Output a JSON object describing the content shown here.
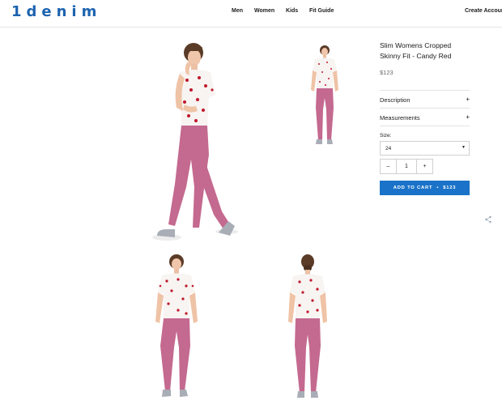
{
  "header": {
    "logo_text": "1denim",
    "nav": [
      {
        "label": "Men"
      },
      {
        "label": "Women"
      },
      {
        "label": "Kids"
      },
      {
        "label": "Fit Guide"
      }
    ],
    "account_label": "Create Account"
  },
  "product": {
    "title": "Slim Womens Cropped Skinny Fit - Candy Red",
    "price": "$123",
    "accordions": [
      {
        "label": "Description",
        "icon": "+"
      },
      {
        "label": "Measurements",
        "icon": "+"
      }
    ],
    "size_label": "Size:",
    "size_value": "24",
    "quantity": {
      "minus": "–",
      "value": "1",
      "plus": "+"
    },
    "add_to_cart": {
      "label": "ADD TO CART",
      "separator": "•",
      "price": "$123"
    }
  },
  "gallery": {
    "images": [
      {
        "name": "model-front-walking-photo",
        "view": "front-walking"
      },
      {
        "name": "model-front-thumbnail-photo",
        "view": "front"
      },
      {
        "name": "model-front-standing-photo",
        "view": "front-standing"
      },
      {
        "name": "model-back-standing-photo",
        "view": "back"
      }
    ]
  },
  "colors": {
    "brand": "#1d63b0",
    "button": "#1a73c8",
    "jeans": "#c4698f",
    "shirt_print": "#c0182b",
    "shoes": "#a8adb6"
  },
  "icons": {
    "share": "share-icon",
    "select_caret": "caret-down-icon"
  }
}
